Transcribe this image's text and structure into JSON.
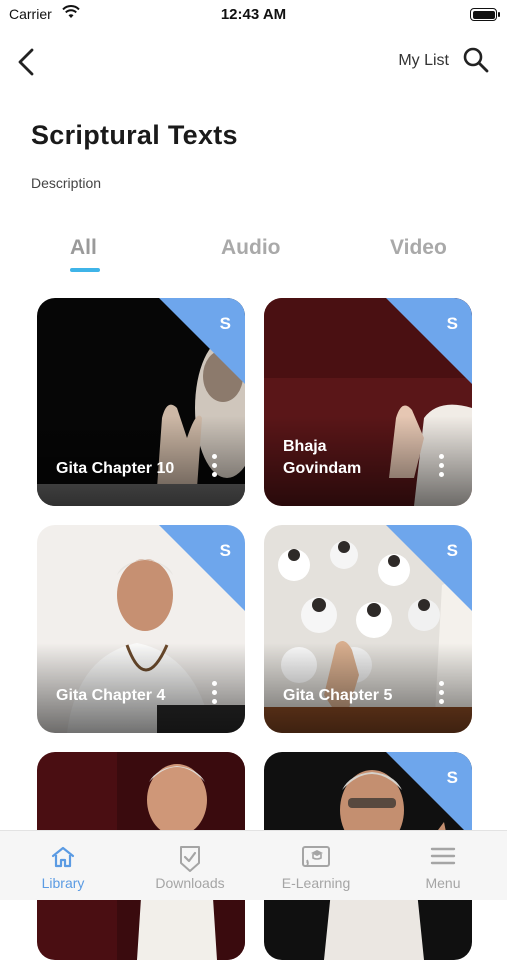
{
  "status_bar": {
    "carrier": "Carrier",
    "time": "12:43 AM"
  },
  "nav": {
    "my_list": "My List",
    "back_icon": "chevron-left-icon",
    "search_icon": "search-icon"
  },
  "page": {
    "title": "Scriptural Texts",
    "description": "Description"
  },
  "tabs": [
    {
      "label": "All",
      "active": true
    },
    {
      "label": "Audio",
      "active": false
    },
    {
      "label": "Video",
      "active": false
    }
  ],
  "cards": [
    {
      "label": "Gita Chapter 10",
      "badge": "S"
    },
    {
      "label": "Bhaja Govindam",
      "badge": "S"
    },
    {
      "label": "Gita Chapter 4",
      "badge": "S"
    },
    {
      "label": "Gita Chapter 5",
      "badge": "S"
    },
    {
      "label": "",
      "badge": ""
    },
    {
      "label": "",
      "badge": "S"
    }
  ],
  "tab_bar": [
    {
      "label": "Library",
      "icon": "home-icon",
      "active": true
    },
    {
      "label": "Downloads",
      "icon": "shield-check-icon",
      "active": false
    },
    {
      "label": "E-Learning",
      "icon": "cast-screen-icon",
      "active": false
    },
    {
      "label": "Menu",
      "icon": "hamburger-menu-icon",
      "active": false
    }
  ],
  "colors": {
    "accent": "#3fb4e8",
    "badge": "#6ea6ec",
    "tab_active": "#5b9be3"
  }
}
